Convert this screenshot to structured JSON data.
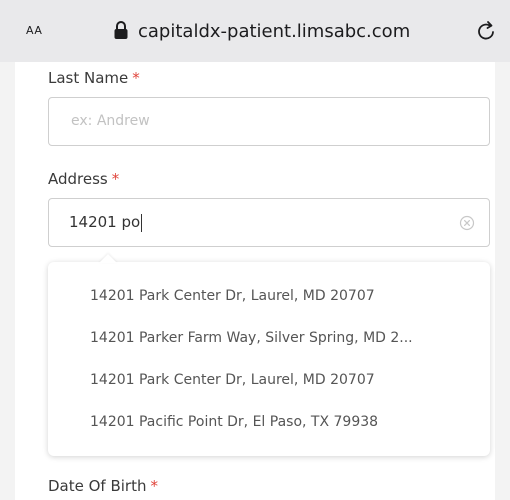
{
  "browser": {
    "text_size_label": "AA",
    "url": "capitaldx-patient.limsabc.com"
  },
  "form": {
    "last_name": {
      "label": "Last Name",
      "required_mark": "*",
      "placeholder": "ex: Andrew"
    },
    "address": {
      "label": "Address",
      "required_mark": "*",
      "value": "14201 po"
    },
    "suggestions": [
      "14201 Park Center Dr, Laurel, MD 20707",
      "14201 Parker Farm Way, Silver Spring, MD 2...",
      "14201 Park Center Dr, Laurel, MD 20707",
      "14201 Pacific Point Dr, El Paso, TX 79938"
    ],
    "date_of_birth": {
      "label": "Date Of Birth",
      "required_mark": "*"
    }
  },
  "colors": {
    "required": "#e0443b",
    "border": "#cfcfcf"
  }
}
